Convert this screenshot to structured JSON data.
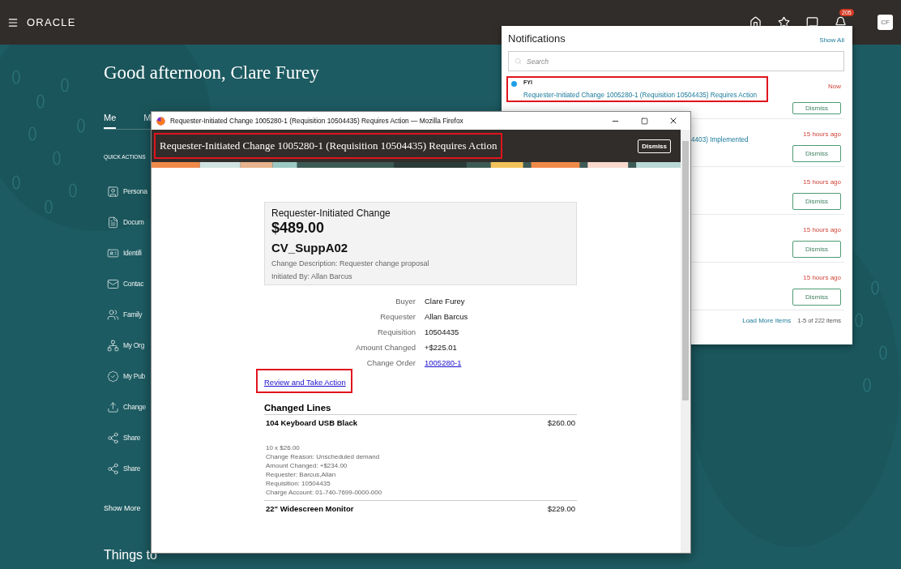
{
  "header": {
    "logo": "ORACLE",
    "notification_count": "205",
    "avatar": "CF"
  },
  "greeting": "Good afternoon, Clare Furey",
  "tabs": [
    {
      "label": "Me",
      "selected": true
    },
    {
      "label": "M",
      "selected": false
    }
  ],
  "quick_actions": {
    "title": "QUICK ACTIONS",
    "items": [
      {
        "kind": "person",
        "label": "Persona"
      },
      {
        "kind": "document",
        "label": "Docum"
      },
      {
        "kind": "idcard",
        "label": "Identifi"
      },
      {
        "kind": "mail",
        "label": "Contac"
      },
      {
        "kind": "family",
        "label": "Family"
      },
      {
        "kind": "org",
        "label": "My Org"
      },
      {
        "kind": "badge",
        "label": "My Pub"
      },
      {
        "kind": "upload",
        "label": "Change"
      },
      {
        "kind": "share",
        "label": "Share"
      },
      {
        "kind": "share",
        "label": "Share"
      }
    ],
    "show_more": "Show More"
  },
  "things_to_finish": "Things to",
  "notifications": {
    "title": "Notifications",
    "show_all": "Show All",
    "search": {
      "placeholder": "Search"
    },
    "items": [
      {
        "kind": "fyi",
        "unread": true,
        "highlighted": true,
        "type": "FYI",
        "message": "Requester-Initiated Change 1005280-1 (Requisition 10504435) Requires Action",
        "time": "Now",
        "dismiss": "Dismiss"
      },
      {
        "kind": "clipped",
        "message": "4403) Implemented",
        "time": "15 hours ago",
        "dismiss": "Dismiss"
      },
      {
        "kind": "clipped",
        "time": "15 hours ago",
        "dismiss": "Dismiss"
      },
      {
        "kind": "clipped",
        "time": "15 hours ago",
        "dismiss": "Dismiss"
      },
      {
        "kind": "clipped",
        "time": "15 hours ago",
        "dismiss": "Dismiss"
      }
    ],
    "load_more": "Load More Items",
    "count": "1-5 of 222 items"
  },
  "popup": {
    "window_title": "Requester-Initiated Change 1005280-1 (Requisition 10504435) Requires Action — Mozilla Firefox",
    "heading": "Requester-Initiated Change 1005280-1 (Requisition 10504435) Requires Action",
    "heading_highlighted": true,
    "dismiss": "Dismiss",
    "summary": {
      "title": "Requester-Initiated Change",
      "amount": "$489.00",
      "supplier": "CV_SuppA02",
      "lines": [
        "Change Description: Requester change proposal",
        "Initiated By: Allan Barcus"
      ]
    },
    "details": [
      {
        "kind": "text",
        "label": "Buyer",
        "value": "Clare Furey"
      },
      {
        "kind": "text",
        "label": "Requester",
        "value": "Allan Barcus"
      },
      {
        "kind": "text",
        "label": "Requisition",
        "value": "10504435"
      },
      {
        "kind": "text",
        "label": "Amount Changed",
        "value": "+$225.01"
      },
      {
        "kind": "link",
        "label": "Change Order",
        "value": "1005280-1"
      }
    ],
    "action_link": {
      "label": "Review and Take Action",
      "highlighted": true
    },
    "changed_lines": {
      "title": "Changed Lines",
      "lines": [
        {
          "name": "104 Keyboard USB Black",
          "amount": "$260.00",
          "details": [
            "10 x $26.00",
            "Change Reason: Unscheduled demand",
            "Amount Changed: +$234.00",
            "Requester: Barcus,Allan",
            "Requisition: 10504435",
            "Charge Account: 01-740-7699-0000-000"
          ]
        },
        {
          "name": "22\" Widescreen Monitor",
          "amount": "$229.00"
        }
      ]
    }
  }
}
